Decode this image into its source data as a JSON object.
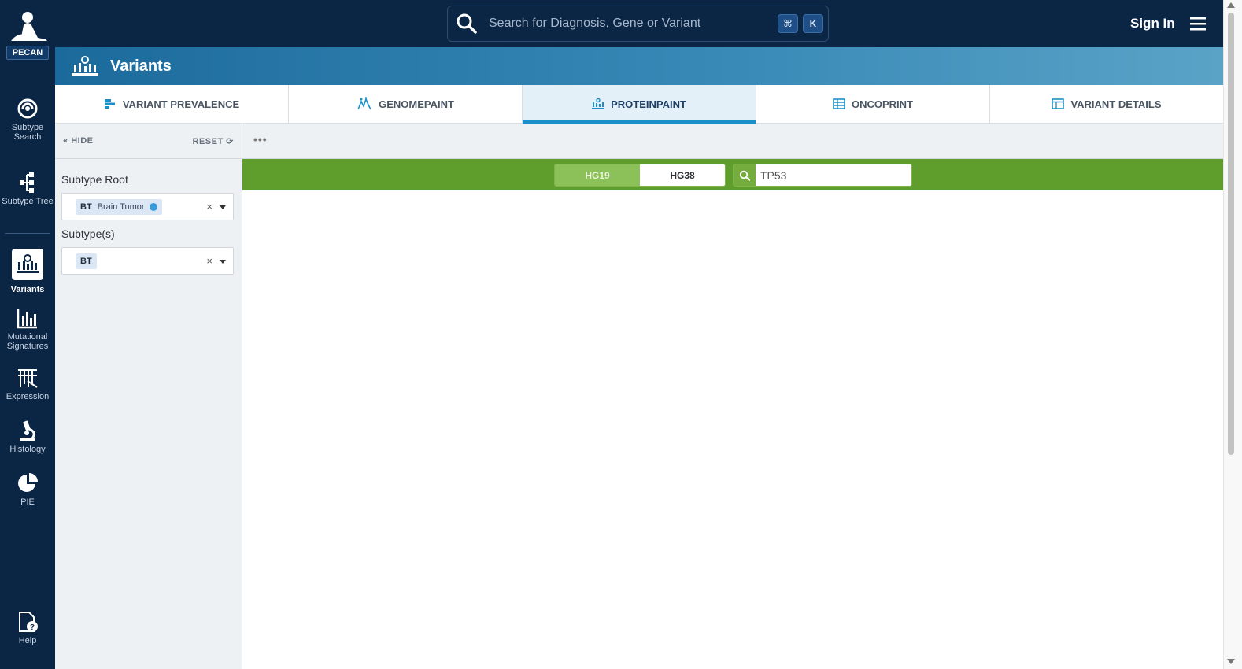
{
  "app": {
    "logo_badge": "PECAN"
  },
  "rail": {
    "items": [
      {
        "label": "Subtype Search",
        "icon": "subtype-search-icon"
      },
      {
        "label": "Subtype Tree",
        "icon": "subtype-tree-icon"
      },
      {
        "label": "Variants",
        "icon": "variants-icon",
        "active": true
      },
      {
        "label": "Mutational Signatures",
        "icon": "mutational-signatures-icon"
      },
      {
        "label": "Expression",
        "icon": "expression-icon"
      },
      {
        "label": "Histology",
        "icon": "microscope-icon"
      },
      {
        "label": "PIE",
        "icon": "pie-chart-icon"
      },
      {
        "label": "Help",
        "icon": "help-document-icon"
      }
    ]
  },
  "topbar": {
    "search_placeholder": "Search for Diagnosis, Gene or Variant",
    "kbd_cmd": "⌘",
    "kbd_k": "K",
    "sign_in": "Sign In"
  },
  "header": {
    "title": "Variants"
  },
  "tabs": [
    {
      "label": "VARIANT PREVALENCE",
      "icon": "bar-list-icon"
    },
    {
      "label": "GENOMEPAINT",
      "icon": "genomepaint-icon"
    },
    {
      "label": "PROTEINPAINT",
      "icon": "proteinpaint-icon",
      "active": true
    },
    {
      "label": "ONCOPRINT",
      "icon": "grid-table-icon"
    },
    {
      "label": "VARIANT DETAILS",
      "icon": "columns-table-icon"
    }
  ],
  "panel": {
    "hide": "HIDE",
    "reset": "RESET",
    "subtype_root_label": "Subtype Root",
    "subtype_root_chip_code": "BT",
    "subtype_root_chip_name": "Brain Tumor",
    "subtypes_label": "Subtype(s)",
    "subtypes_chip_code": "BT",
    "clear": "×"
  },
  "main": {
    "more": "•••",
    "genome_builds": [
      "HG19",
      "HG38"
    ],
    "selected_build": "HG38",
    "gene_query": "TP53"
  },
  "colors": {
    "rail_bg": "#0b2545",
    "band_start": "#1b6a9c",
    "accent": "#1d8fc8",
    "green_bar": "#5f9e2c"
  }
}
